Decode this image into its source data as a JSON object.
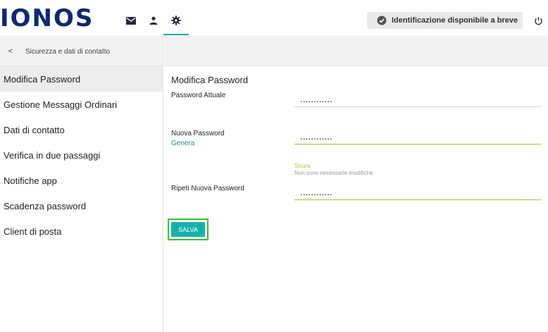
{
  "brand": {
    "logo_text": "IONOS",
    "logo_color": "#0b2a6f"
  },
  "topbar": {
    "icons": [
      "envelope-icon",
      "person-icon",
      "gear-icon"
    ],
    "active_tab": "gear-icon",
    "badge_label": "Identificazione disponibile a breve",
    "badge_icon": "verified-badge-icon",
    "power_icon": "power-icon"
  },
  "sidebar": {
    "header_title": "Sicurezza e dati di contatto",
    "back_glyph": "<",
    "items": [
      {
        "label": "Modifica Password",
        "active": true
      },
      {
        "label": "Gestione Messaggi Ordinari",
        "active": false
      },
      {
        "label": "Dati di contatto",
        "active": false
      },
      {
        "label": "Verifica in due passaggi",
        "active": false
      },
      {
        "label": "Notifiche app",
        "active": false
      },
      {
        "label": "Scadenza password",
        "active": false
      },
      {
        "label": "Client di posta",
        "active": false
      }
    ]
  },
  "form": {
    "title": "Modifica Password",
    "current_password": {
      "label": "Password Attuale",
      "value": "............"
    },
    "new_password": {
      "label": "Nuova Password",
      "link": "Genera",
      "value": "............"
    },
    "strength": {
      "level": "Sicura",
      "note": "Non sono necessarie modifiche"
    },
    "repeat_password": {
      "label": "Ripeti Nuova Password",
      "value": "............"
    },
    "save_label": "SALVA"
  },
  "colors": {
    "accent": "#16b2a9",
    "link": "#1a8f8a",
    "strength_ok": "#a8c12a",
    "highlight_outline": "#35c235"
  }
}
